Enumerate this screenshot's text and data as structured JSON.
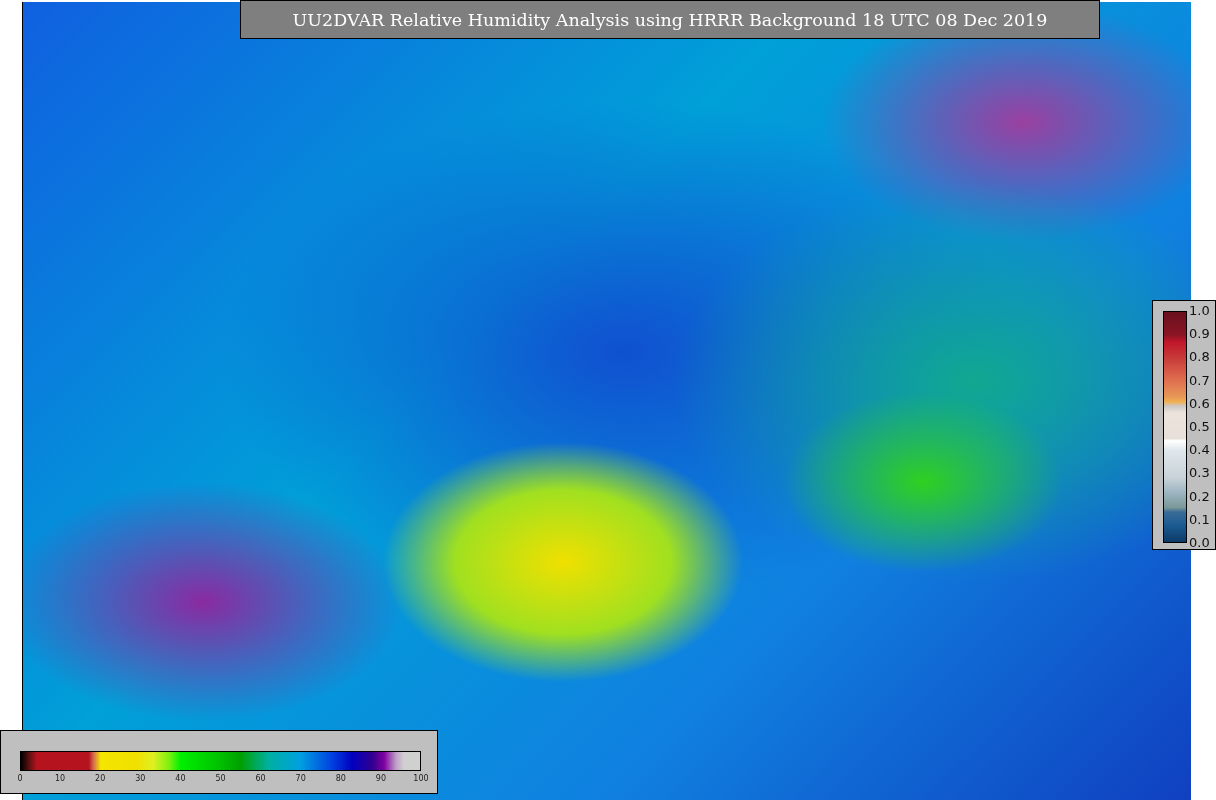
{
  "title": "UU2DVAR Relative Humidity Analysis using HRRR Background 18 UTC 08 Dec 2019",
  "humidity_colorbar": {
    "tick_labels": [
      "0",
      "10",
      "20",
      "30",
      "40",
      "50",
      "60",
      "70",
      "80",
      "90",
      "100"
    ]
  },
  "ratio_colorbar": {
    "tick_labels": [
      "1.0",
      "0.9",
      "0.8",
      "0.7",
      "0.6",
      "0.5",
      "0.4",
      "0.3",
      "0.2",
      "0.1",
      "0.0"
    ]
  }
}
